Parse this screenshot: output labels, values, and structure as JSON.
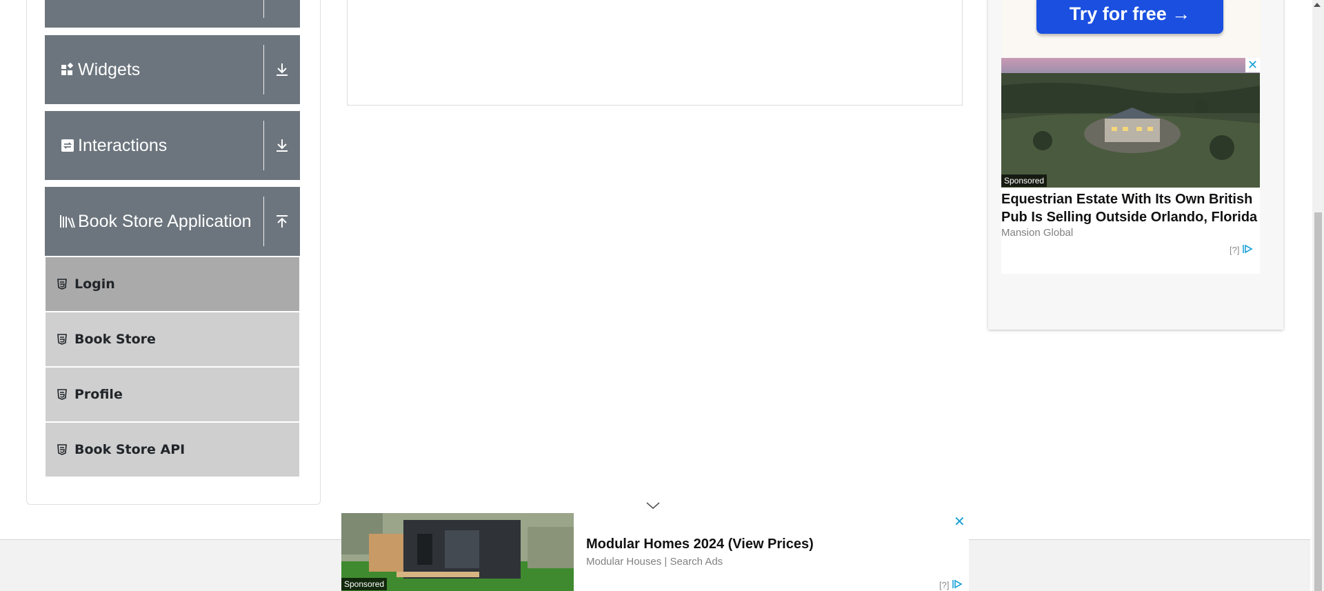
{
  "sidebar": {
    "groups": [
      {
        "label": "Widgets",
        "icon": "widgets-icon",
        "toggle": "download-icon"
      },
      {
        "label": "Interactions",
        "icon": "interactions-icon",
        "toggle": "download-icon"
      },
      {
        "label": "Book Store Application",
        "icon": "book-shelf-icon",
        "toggle": "upload-icon"
      }
    ],
    "items": [
      {
        "label": "Login",
        "icon": "html5-icon",
        "active": true
      },
      {
        "label": "Book Store",
        "icon": "html5-icon",
        "active": false
      },
      {
        "label": "Profile",
        "icon": "html5-icon",
        "active": false
      },
      {
        "label": "Book Store API",
        "icon": "html5-icon",
        "active": false
      }
    ]
  },
  "right_ad": {
    "cta_label": "Try for free →",
    "sponsored_label": "Sponsored",
    "title": "Equestrian Estate With Its Own British Pub Is Selling Outside Orlando, Florida",
    "source": "Mansion Global",
    "info_label": "[?]",
    "close_label": "✕"
  },
  "bottom_ad": {
    "sponsored_label": "Sponsored",
    "title": "Modular Homes 2024 (View Prices)",
    "source": "Modular Houses | Search Ads",
    "info_label": "[?]",
    "close_label": "✕"
  },
  "colors": {
    "group_header_bg": "#6c757d",
    "menu_item_bg": "#cfcfcf",
    "menu_item_active_bg": "#aaaaaa",
    "cta_bg": "#1a4fe0",
    "ad_accent": "#1aa0d8"
  }
}
